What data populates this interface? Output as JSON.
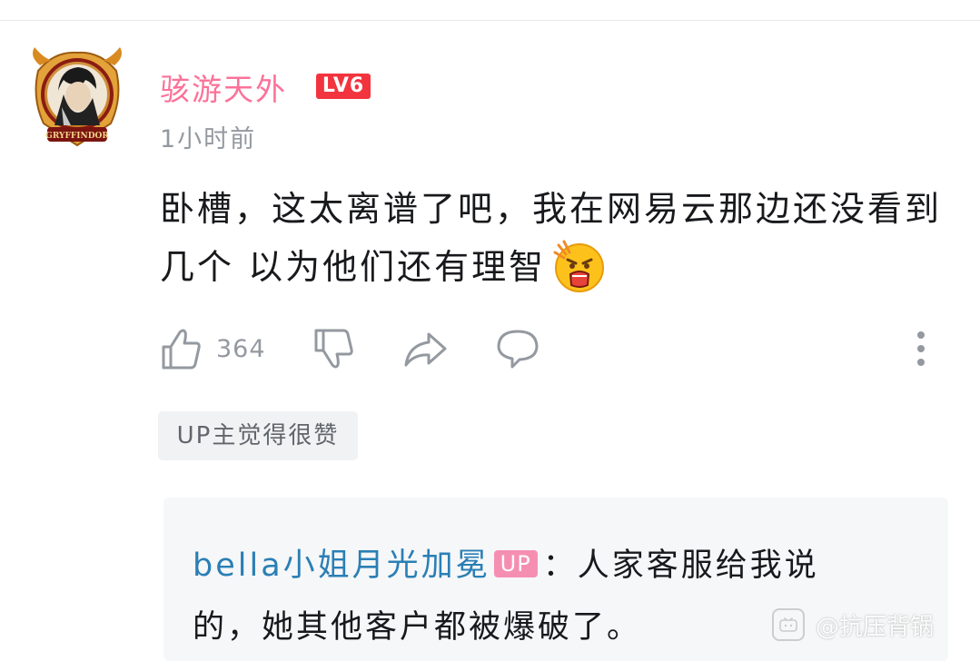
{
  "comment": {
    "username": "骇游天外",
    "level_badge": "LV6",
    "time": "1小时前",
    "text": "卧槽，这太离谱了吧，我在网易云那边还没看到几个 以为他们还有理智",
    "emoji": "shocked-face-emoji",
    "like_count": "364",
    "up_liked_tag": "UP主觉得很赞",
    "avatar_caption": "GRYFFINDOR"
  },
  "reply": {
    "username": "bella小姐月光加冕",
    "up_badge": "UP",
    "line1_text": "：人家客服给我说",
    "line2_text": "的，她其他客户都被爆破了。"
  },
  "watermark": {
    "text": "@抗压背锅",
    "icon": "bilibili-tv-icon"
  },
  "colors": {
    "username": "#fb7299",
    "level_badge": "#f2343e",
    "reply_username": "#2a7fb5",
    "up_badge": "#f58fb1",
    "secondary_text": "#9499a0"
  }
}
